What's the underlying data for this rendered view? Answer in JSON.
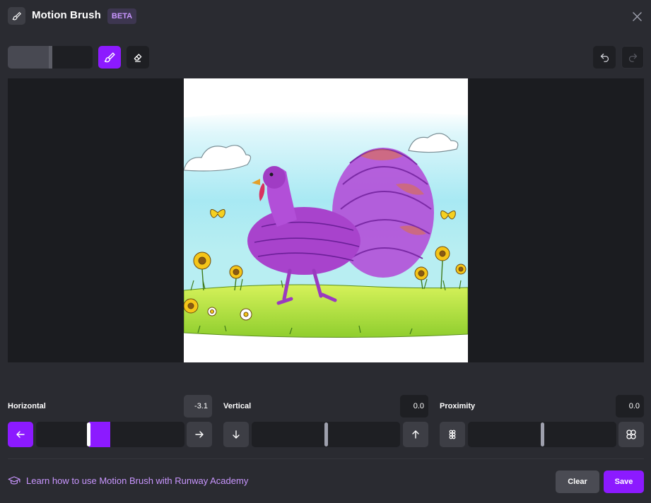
{
  "header": {
    "title": "Motion Brush",
    "badge": "BETA"
  },
  "toolbar": {
    "brush_size": 0.5
  },
  "controls": {
    "horizontal": {
      "label": "Horizontal",
      "value": "-3.1",
      "level": -3.1
    },
    "vertical": {
      "label": "Vertical",
      "value": "0.0",
      "level": 0.0
    },
    "proximity": {
      "label": "Proximity",
      "value": "0.0",
      "level": 0.0
    }
  },
  "footer": {
    "learn_link": "Learn how to use Motion Brush with Runway Academy",
    "clear_label": "Clear",
    "save_label": "Save"
  },
  "colors": {
    "accent": "#8c1aff",
    "link": "#c996ff",
    "background": "#2a2b31"
  }
}
